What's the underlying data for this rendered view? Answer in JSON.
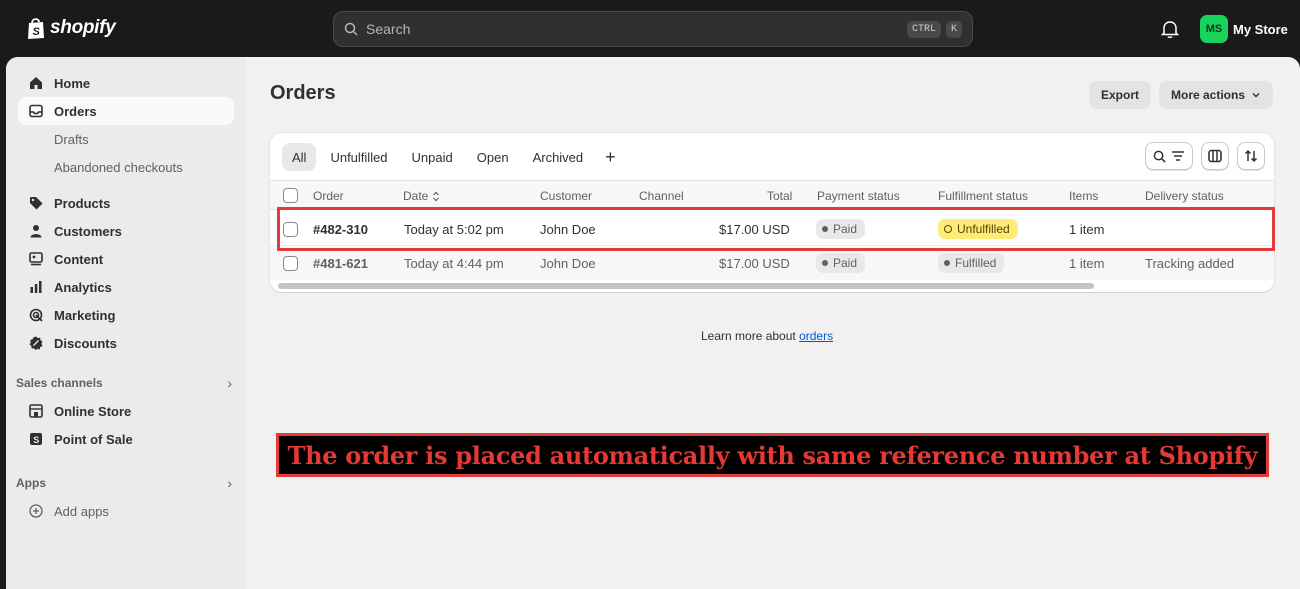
{
  "topbar": {
    "brand": "shopify",
    "search_placeholder": "Search",
    "shortcut_ctrl": "CTRL",
    "shortcut_key": "K",
    "avatar_initials": "MS",
    "store_name": "My Store",
    "colors": {
      "bar": "#1a1a1a",
      "avatar": "#1ad35d"
    }
  },
  "sidebar": {
    "items": [
      {
        "label": "Home",
        "icon": "home-icon"
      },
      {
        "label": "Orders",
        "icon": "orders-icon",
        "active": true
      },
      {
        "label": "Products",
        "icon": "tag-icon"
      },
      {
        "label": "Customers",
        "icon": "person-icon"
      },
      {
        "label": "Content",
        "icon": "content-icon"
      },
      {
        "label": "Analytics",
        "icon": "bar-chart-icon"
      },
      {
        "label": "Marketing",
        "icon": "target-icon"
      },
      {
        "label": "Discounts",
        "icon": "discount-icon"
      }
    ],
    "order_subitems": [
      "Drafts",
      "Abandoned checkouts"
    ],
    "sales_channels_label": "Sales channels",
    "channels": [
      {
        "label": "Online Store",
        "icon": "store-icon"
      },
      {
        "label": "Point of Sale",
        "icon": "pos-icon"
      }
    ],
    "apps_label": "Apps",
    "add_apps_label": "Add apps"
  },
  "page": {
    "title": "Orders",
    "export_label": "Export",
    "more_actions_label": "More actions"
  },
  "tabs": [
    "All",
    "Unfulfilled",
    "Unpaid",
    "Open",
    "Archived",
    "+"
  ],
  "table": {
    "headers": [
      "Order",
      "Date",
      "Customer",
      "Channel",
      "Total",
      "Payment status",
      "Fulfillment status",
      "Items",
      "Delivery status"
    ],
    "rows": [
      {
        "order": "#482-310",
        "date": "Today at 5:02 pm",
        "customer": "John Doe",
        "channel": "",
        "total": "$17.00 USD",
        "payment": "Paid",
        "fulfillment": "Unfulfilled",
        "items": "1 item",
        "delivery": ""
      },
      {
        "order": "#481-621",
        "date": "Today at 4:44 pm",
        "customer": "John Doe",
        "channel": "",
        "total": "$17.00 USD",
        "payment": "Paid",
        "fulfillment": "Fulfilled",
        "items": "1 item",
        "delivery": "Tracking added"
      }
    ]
  },
  "learn_more": {
    "prefix": "Learn more about ",
    "link": "orders"
  },
  "annotation": {
    "text": "The order is placed automatically with same reference number at Shopify",
    "color": "#e53935"
  }
}
